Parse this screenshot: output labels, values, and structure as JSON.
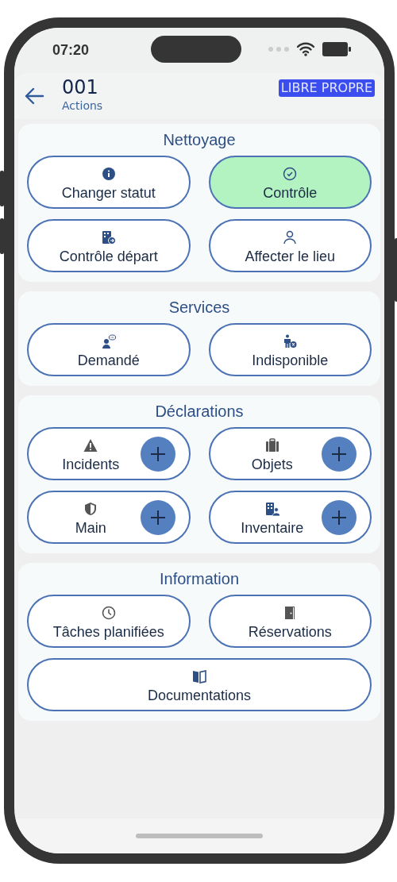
{
  "status_bar": {
    "time": "07:20"
  },
  "header": {
    "title": "001",
    "subtitle": "Actions",
    "badge": "LIBRE PROPRE"
  },
  "sections": [
    {
      "title": "Nettoyage",
      "actions": [
        {
          "label": "Changer statut",
          "kind": "plain",
          "selected": false
        },
        {
          "label": "Contrôle",
          "kind": "plain",
          "selected": true
        },
        {
          "label": "Contrôle départ",
          "kind": "plain",
          "selected": false
        },
        {
          "label": "Affecter le lieu",
          "kind": "plain",
          "selected": false
        }
      ]
    },
    {
      "title": "Services",
      "actions": [
        {
          "label": "Demandé",
          "kind": "plain",
          "selected": false
        },
        {
          "label": "Indisponible",
          "kind": "plain",
          "selected": false
        }
      ]
    },
    {
      "title": "Déclarations",
      "actions": [
        {
          "label": "Incidents",
          "kind": "add",
          "selected": false
        },
        {
          "label": "Objets",
          "kind": "add",
          "selected": false
        },
        {
          "label": "Main",
          "kind": "add",
          "selected": false
        },
        {
          "label": "Inventaire",
          "kind": "add",
          "selected": false
        }
      ]
    },
    {
      "title": "Information",
      "actions": [
        {
          "label": "Tâches planifiées",
          "kind": "plain",
          "selected": false
        },
        {
          "label": "Réservations",
          "kind": "plain",
          "selected": false
        },
        {
          "label": "Documentations",
          "kind": "wide",
          "selected": false
        }
      ]
    }
  ]
}
